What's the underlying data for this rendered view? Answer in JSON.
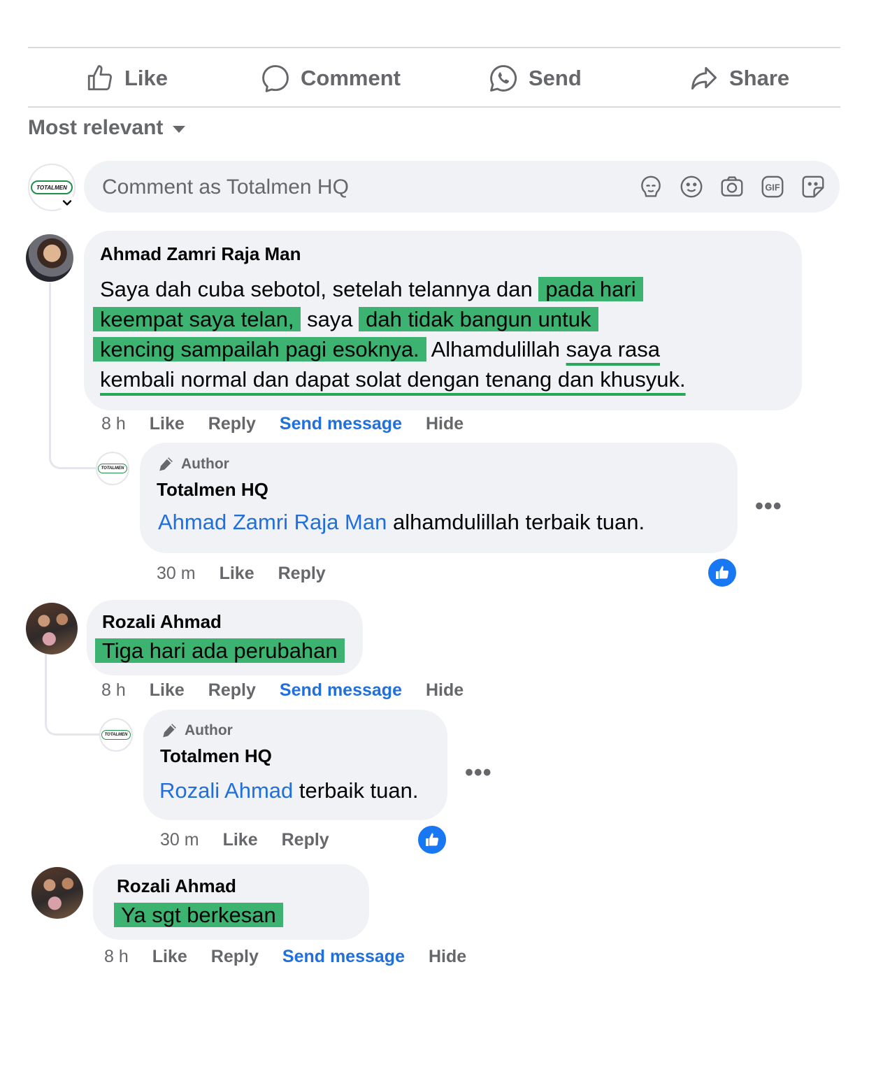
{
  "actions": {
    "like": "Like",
    "comment": "Comment",
    "send": "Send",
    "share": "Share"
  },
  "sort": {
    "label": "Most relevant"
  },
  "composer": {
    "placeholder": "Comment as Totalmen HQ",
    "avatar_logo": "TOTALMEN",
    "icons": [
      "avatar-sticker-icon",
      "emoji-icon",
      "camera-icon",
      "gif-icon",
      "sticker-icon"
    ]
  },
  "comments": [
    {
      "name": "Ahmad Zamri Raja Man",
      "lines": [
        {
          "a": "Saya dah cuba sebotol, setelah telannya dan ",
          "hl": "pada hari"
        },
        {
          "hl1": "keempat saya telan,",
          "b": " saya ",
          "hl2": "dah tidak bangun untuk"
        },
        {
          "hl": "kencing sampailah pagi esoknya.",
          "b": " Alhamdulillah ",
          "ul": "saya rasa"
        },
        {
          "ul": "kembali normal dan dapat solat dengan tenang dan khusyuk."
        }
      ],
      "time": "8 h",
      "like": "Like",
      "reply": "Reply",
      "send_message": "Send message",
      "hide": "Hide",
      "reply_item": {
        "badge": "Author",
        "name": "Totalmen HQ",
        "mention": "Ahmad Zamri Raja Man",
        "text": " alhamdulillah terbaik tuan.",
        "time": "30 m",
        "like": "Like",
        "reply": "Reply"
      }
    },
    {
      "name": "Rozali Ahmad",
      "text": "Tiga hari ada perubahan",
      "time": "8 h",
      "like": "Like",
      "reply": "Reply",
      "send_message": "Send message",
      "hide": "Hide",
      "reply_item": {
        "badge": "Author",
        "name": "Totalmen HQ",
        "mention": "Rozali Ahmad",
        "text": " terbaik tuan.",
        "time": "30 m",
        "like": "Like",
        "reply": "Reply"
      }
    },
    {
      "name": "Rozali Ahmad",
      "text": "Ya sgt berkesan",
      "time": "8 h",
      "like": "Like",
      "reply": "Reply",
      "send_message": "Send message",
      "hide": "Hide"
    }
  ],
  "colors": {
    "highlight": "#3cb371",
    "underline": "#2aa85a",
    "link": "#216fdb",
    "muted": "#65676b",
    "bubble": "#f0f2f5",
    "like_badge": "#1877f2"
  }
}
